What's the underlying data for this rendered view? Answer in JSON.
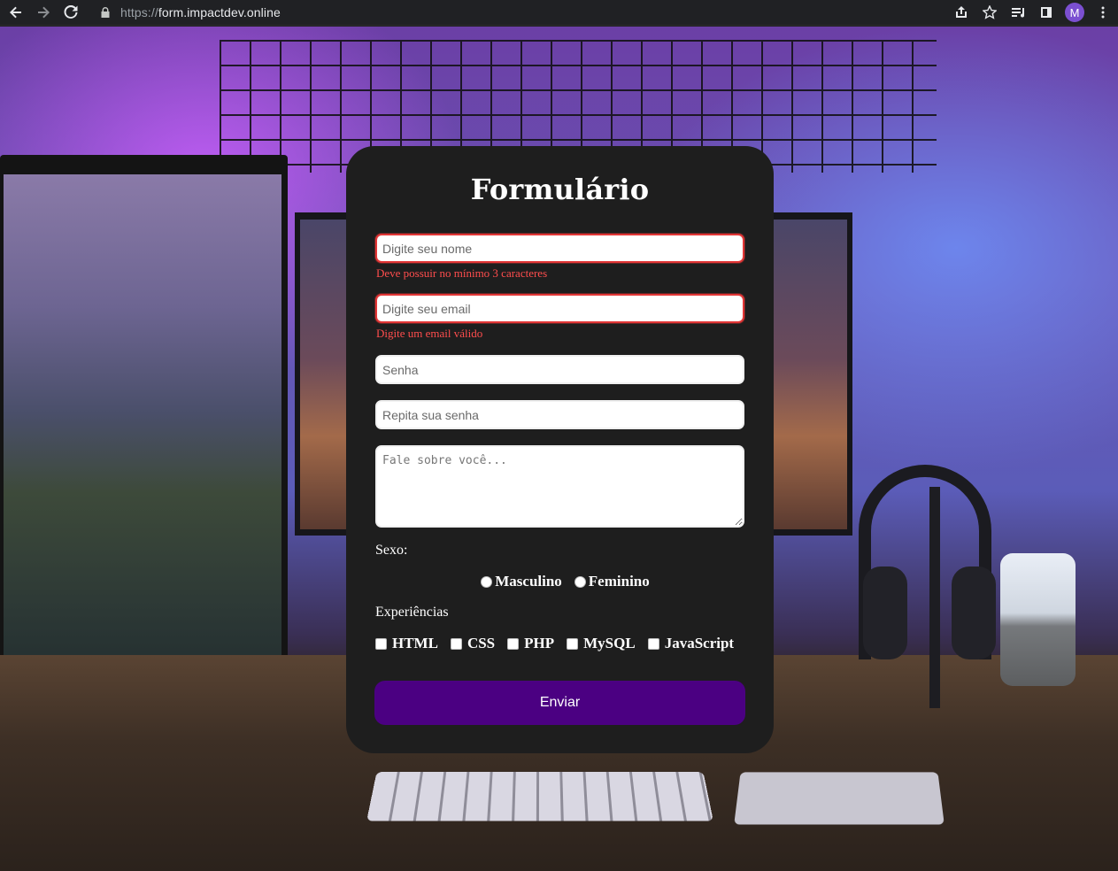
{
  "browser": {
    "url_scheme": "https://",
    "url_host": "form.impactdev.online",
    "profile_initial": "M"
  },
  "form": {
    "title": "Formulário",
    "name": {
      "placeholder": "Digite seu nome",
      "value": "",
      "error": "Deve possuir no mínimo 3 caracteres"
    },
    "email": {
      "placeholder": "Digite seu email",
      "value": "",
      "error": "Digite um email válido"
    },
    "password": {
      "placeholder": "Senha",
      "value": ""
    },
    "password_confirm": {
      "placeholder": "Repita sua senha",
      "value": ""
    },
    "about": {
      "placeholder": "Fale sobre você...",
      "value": ""
    },
    "sex_label": "Sexo:",
    "sex_options": [
      "Masculino",
      "Feminino"
    ],
    "experience_label": "Experiências",
    "experience_options": [
      "HTML",
      "CSS",
      "PHP",
      "MySQL",
      "JavaScript"
    ],
    "submit_label": "Enviar"
  },
  "colors": {
    "card_bg": "#1e1e1e",
    "submit_bg": "#4b0082",
    "error": "#ff4d4d",
    "invalid_border": "#e23636"
  }
}
